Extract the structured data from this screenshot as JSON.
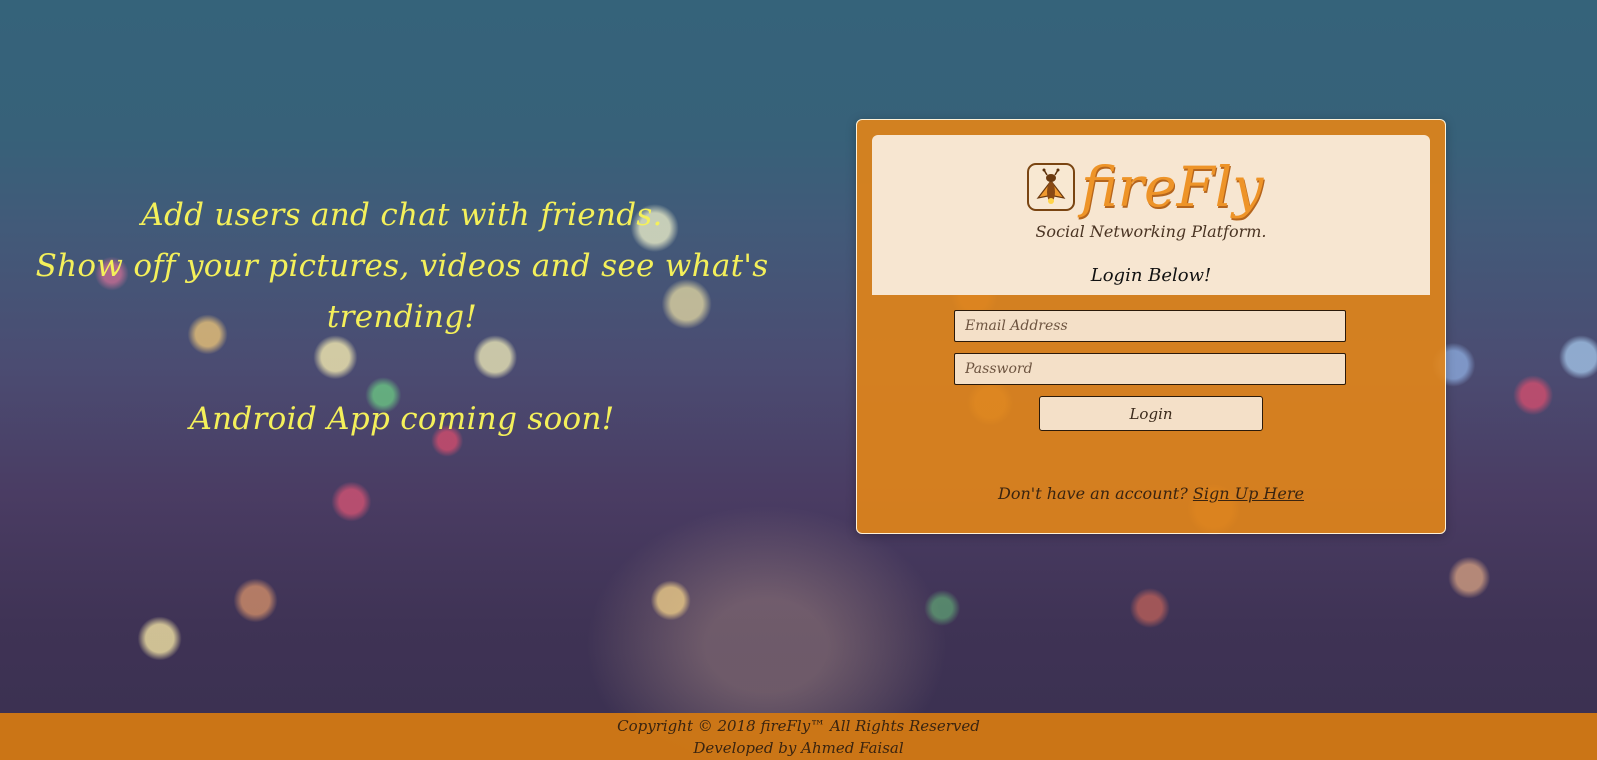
{
  "hero": {
    "line1": "Add users and chat with friends.",
    "line2": "Show off your pictures, videos and see what's trending!",
    "line3": "Android App coming soon!"
  },
  "login_card": {
    "logo_icon": "firefly-icon",
    "brand_name": "fireFly",
    "tagline": "Social Networking Platform.",
    "heading": "Login Below!",
    "email_placeholder": "Email Address",
    "password_placeholder": "Password",
    "login_label": "Login",
    "signup_prompt": "Don't have an account?",
    "signup_link": "Sign Up Here"
  },
  "footer": {
    "copyright": "Copyright © 2018 fireFly™ All Rights Reserved",
    "developer": "Developed by Ahmed Faisal"
  },
  "colors": {
    "accent": "#e0841a",
    "hero_text": "#f4f05a",
    "panel": "#f7e6d1"
  }
}
